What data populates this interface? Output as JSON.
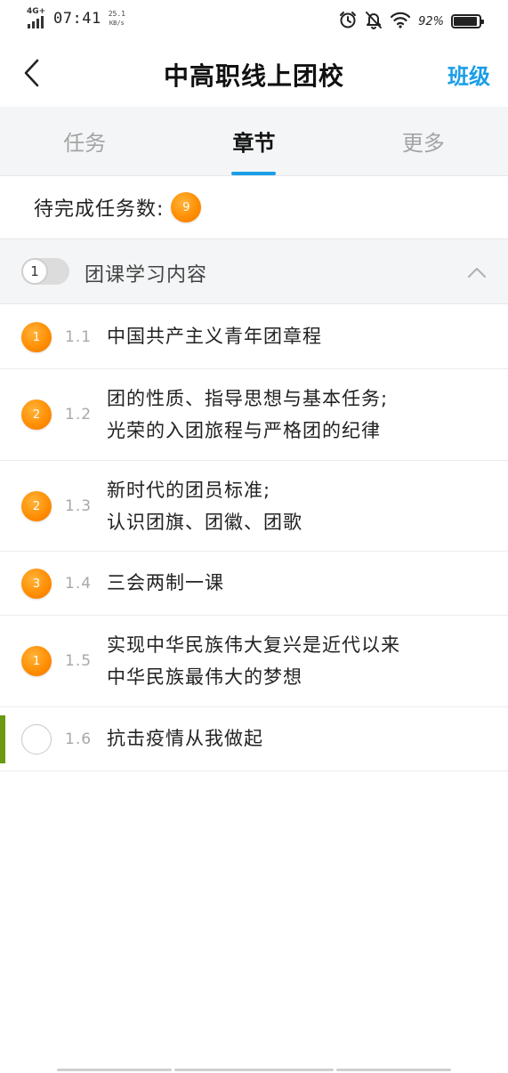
{
  "status_bar": {
    "network": "4G+",
    "time": "07:41",
    "speed_value": "25.1",
    "speed_unit": "KB/s",
    "battery_percent": "92%",
    "battery_level": 0.92,
    "icons": [
      "alarm-icon",
      "mute-bell-icon",
      "wifi-icon",
      "battery-icon"
    ]
  },
  "header": {
    "back_icon": "chevron-left-icon",
    "title": "中高职线上团校",
    "class_link": "班级",
    "accent_color": "#1a9ee8"
  },
  "tabs": [
    {
      "label": "任务",
      "active": false
    },
    {
      "label": "章节",
      "active": true
    },
    {
      "label": "更多",
      "active": false
    }
  ],
  "pending": {
    "label": "待完成任务数:",
    "count": "9"
  },
  "section": {
    "number": "1",
    "title": "团课学习内容",
    "collapse_icon": "chevron-up-icon"
  },
  "chapters": [
    {
      "badge": "1",
      "num": "1.1",
      "title_lines": [
        "中国共产主义青年团章程"
      ]
    },
    {
      "badge": "2",
      "num": "1.2",
      "title_lines": [
        "团的性质、指导思想与基本任务;",
        "光荣的入团旅程与严格团的纪律"
      ]
    },
    {
      "badge": "2",
      "num": "1.3",
      "title_lines": [
        "新时代的团员标准;",
        "认识团旗、团徽、团歌"
      ]
    },
    {
      "badge": "3",
      "num": "1.4",
      "title_lines": [
        "三会两制一课"
      ]
    },
    {
      "badge": "1",
      "num": "1.5",
      "title_lines": [
        "实现中华民族伟大复兴是近代以来",
        "中华民族最伟大的梦想"
      ]
    },
    {
      "badge": "",
      "num": "1.6",
      "title_lines": [
        "抗击疫情从我做起"
      ],
      "current": true
    }
  ],
  "colors": {
    "badge_orange": "#ff8c00",
    "current_marker": "#6b9a12",
    "tab_background": "#f4f5f6"
  }
}
